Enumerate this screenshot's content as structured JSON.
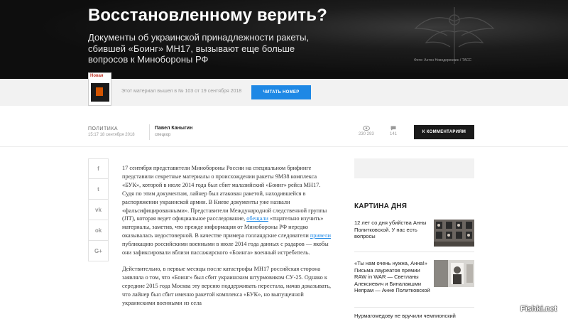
{
  "hero": {
    "title": "Восстановленному верить?",
    "subtitle": "Документы об украинской принадлежности ракеты, сбившей «Боинг» МН17, вызывают еще больше вопросов к Минобороны РФ",
    "photo_credit": "Фото: Антон Новодережкин / ТАСС"
  },
  "issue": {
    "cover_logo": "Новая",
    "text": "Этот материал вышел в № 103 от 19 сентября 2018",
    "button_label": "ЧИТАТЬ НОМЕР"
  },
  "meta": {
    "rubric": "ПОЛИТИКА",
    "date": "15:17 18 сентября 2018",
    "author": "Павел Каныгин",
    "author_role": "спецкор",
    "views": "230 293",
    "comments": "141",
    "comment_button": "К КОММЕНТАРИЯМ"
  },
  "share": {
    "items": [
      "f",
      "t",
      "vk",
      "ok",
      "G+"
    ]
  },
  "article": {
    "p1_a": "17 сентября представители Минобороны России на специальном брифинге представили секретные материалы о происхождении ракеты 9М38 комплекса «БУК», которой в июле 2014 года был сбит малазийский «Боинг» рейса МН17. Судя по этим документам, лайнер был атакован ракетой, находившейся в распоряжении украинской армии. В Киеве документы уже назвали «фальсифицированными». Представители Международной следственной группы (JIT), которая ведет официальное расследование,",
    "p1_link1": "обещали",
    "p1_b": "«тщательно изучить» материалы, заметив, что прежде информация от Минобороны РФ нередко оказывалась недостоверной. В качестве примера голландские следователи",
    "p1_link2": "привели",
    "p1_c": "публикацию российскими военными в июле 2014 года данных с радаров — якобы они зафиксировали вблизи пассажирского «Боинга» военный истребитель.",
    "p2": "Действительно, в первые месяцы после катастрофы МН17 российская сторона заявляла о том, что «Боинг» был сбит украинским штурмовиком СУ-25. Однако к середине 2015 года Москва эту версию поддерживать перестала, начав доказывать, что лайнер был сбит именно ракетой комплекса «БУК», но выпущенной украинскими военными из села"
  },
  "sidebar": {
    "section_title": "КАРТИНА ДНЯ",
    "items": [
      {
        "text": "12 лет со дня убийства Анны Политковской. У нас есть вопросы"
      },
      {
        "text": "«Ты нам очень нужна, Анна!» Письма лауреатов премии RAW in WAR — Светланы Алексиевич и Биналакшми Непрам — Анне Политковской"
      },
      {
        "text": "Нурмагомедову не вручили чемпионский"
      }
    ]
  },
  "watermark": "Fishki.net",
  "colors": {
    "accent": "#1e88e5",
    "dark_button": "#1a1a1a",
    "issue_bar": "#f2f2f2"
  }
}
